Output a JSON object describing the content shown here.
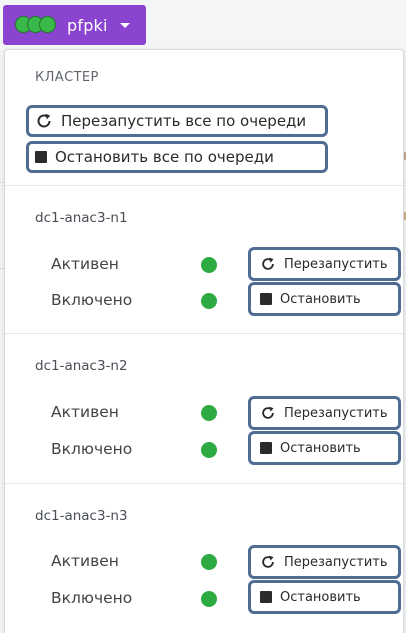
{
  "cluster": {
    "name": "pfpki"
  },
  "dropdown": {
    "section_title": "КЛАСТЕР",
    "restart_all_label": "Перезапустить все по очереди",
    "stop_all_label": "Остановить все по очереди"
  },
  "nodes": [
    {
      "name": "dc1-anac3-n1",
      "state_label": "Активен",
      "enabled_label": "Включено",
      "restart_label": "Перезапустить",
      "stop_label": "Остановить"
    },
    {
      "name": "dc1-anac3-n2",
      "state_label": "Активен",
      "enabled_label": "Включено",
      "restart_label": "Перезапустить",
      "stop_label": "Остановить"
    },
    {
      "name": "dc1-anac3-n3",
      "state_label": "Активен",
      "enabled_label": "Включено",
      "restart_label": "Перезапустить",
      "stop_label": "Остановить"
    }
  ],
  "colors": {
    "brand": "#8a44d0",
    "status_ok": "#2eaa42",
    "highlight_border": "#4f6c92"
  },
  "icons": {
    "restart": "restart-icon",
    "stop": "stop-icon",
    "caret": "chevron-down-icon"
  }
}
